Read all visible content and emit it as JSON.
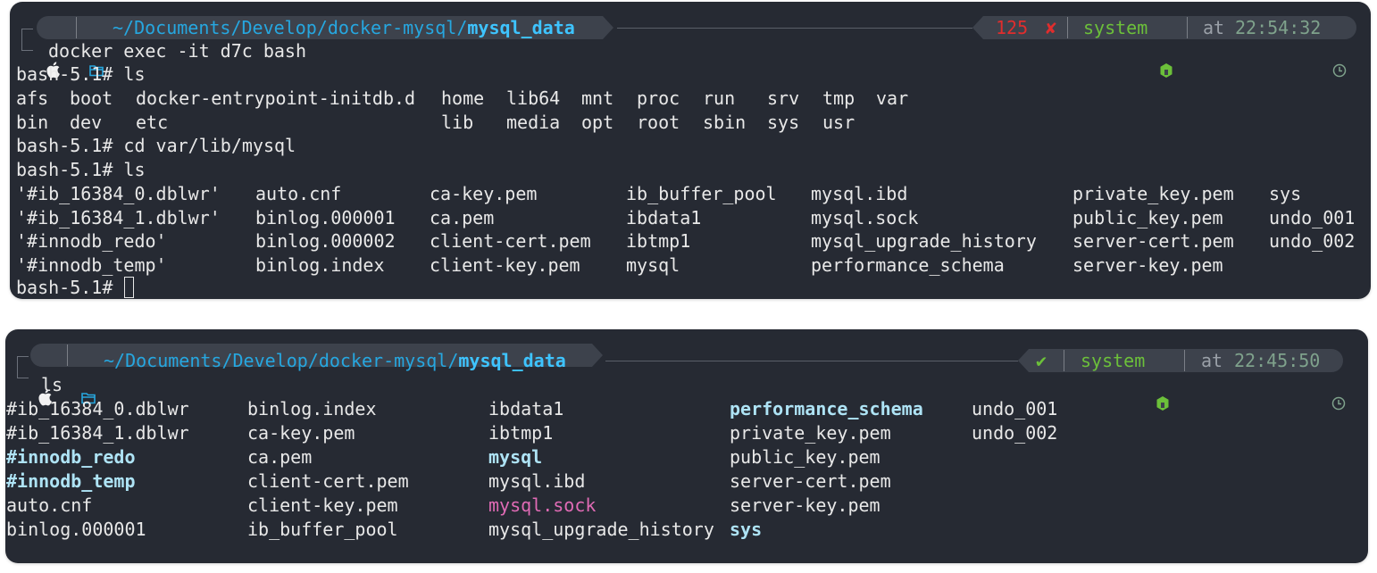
{
  "term1": {
    "prompt": {
      "path_prefix": "~/Documents/Develop/docker-mysql/",
      "path_dir": "mysql_data",
      "exit_code": "125",
      "fail_mark": "✘",
      "env": "system",
      "at_label": "at",
      "time": "22:54:32"
    },
    "command": "docker exec -it d7c bash",
    "lines": [
      "bash-5.1# ls",
      "bash-5.1# cd var/lib/mysql",
      "bash-5.1# ls",
      "bash-5.1# "
    ],
    "ls_root": [
      [
        "afs",
        "boot",
        "docker-entrypoint-initdb.d",
        "home",
        "lib64",
        "mnt",
        "proc",
        "run",
        "srv",
        "tmp",
        "var"
      ],
      [
        "bin",
        "dev",
        "etc",
        "",
        "lib",
        "media",
        "opt",
        "root",
        "sbin",
        "sys",
        "usr"
      ]
    ],
    "ls_mysql": [
      [
        "'#ib_16384_0.dblwr'",
        "auto.cnf",
        "ca-key.pem",
        "ib_buffer_pool",
        "mysql.ibd",
        "private_key.pem",
        "sys"
      ],
      [
        "'#ib_16384_1.dblwr'",
        "binlog.000001",
        "ca.pem",
        "ibdata1",
        "mysql.sock",
        "public_key.pem",
        "undo_001"
      ],
      [
        "'#innodb_redo'",
        "binlog.000002",
        "client-cert.pem",
        "ibtmp1",
        "mysql_upgrade_history",
        "server-cert.pem",
        "undo_002"
      ],
      [
        "'#innodb_temp'",
        "binlog.index",
        "client-key.pem",
        "mysql",
        "performance_schema",
        "server-key.pem",
        ""
      ]
    ]
  },
  "term2": {
    "prompt": {
      "path_prefix": "~/Documents/Develop/docker-mysql/",
      "path_dir": "mysql_data",
      "ok_mark": "✔",
      "env": "system",
      "at_label": "at",
      "time": "22:45:50"
    },
    "command": "ls",
    "rows": [
      [
        "#ib_16384_0.dblwr",
        "binlog.index",
        "ibdata1",
        "performance_schema",
        "undo_001"
      ],
      [
        "#ib_16384_1.dblwr",
        "ca-key.pem",
        "ibtmp1",
        "private_key.pem",
        "undo_002"
      ],
      [
        "#innodb_redo",
        "ca.pem",
        "mysql",
        "public_key.pem",
        ""
      ],
      [
        "#innodb_temp",
        "client-cert.pem",
        "mysql.ibd",
        "server-cert.pem",
        ""
      ],
      [
        "auto.cnf",
        "client-key.pem",
        "mysql.sock",
        "server-key.pem",
        ""
      ],
      [
        "binlog.000001",
        "ib_buffer_pool",
        "mysql_upgrade_history",
        "sys",
        ""
      ]
    ],
    "styles": {
      "#innodb_redo": "bold-cyan",
      "#innodb_temp": "bold-cyan",
      "mysql": "bold-cyan",
      "performance_schema": "bold-cyan",
      "sys": "bold-cyan",
      "mysql.sock": "pink"
    }
  },
  "icons": {
    "apple": "apple-icon",
    "folder": "folder-icon",
    "node": "node-icon",
    "clock": "clock-icon"
  },
  "colors": {
    "background": "#262a33",
    "path": "#26a7e0",
    "error": "#e02d2d",
    "success": "#6cc03a",
    "dir": "#aee3f5",
    "socket": "#e06bb5"
  }
}
